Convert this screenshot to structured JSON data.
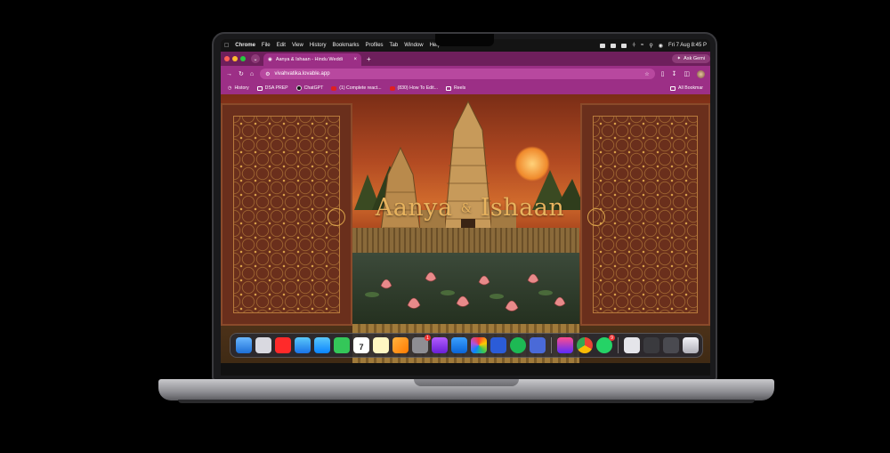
{
  "menubar": {
    "apple_icon": "apple-icon",
    "app_name": "Chrome",
    "menus": [
      "File",
      "Edit",
      "View",
      "History",
      "Bookmarks",
      "Profiles",
      "Tab",
      "Window",
      "Help"
    ],
    "clock": "Fri 7 Aug  8:45 P"
  },
  "tabs": [
    {
      "title": "Aanya & Ishaan - Hindu Weddi"
    }
  ],
  "ask_gemini": "Ask Gemi",
  "address": {
    "url": "vivahvatika.lovable.app"
  },
  "bookmarks": {
    "items": [
      {
        "label": "History",
        "icon": "clock-icon"
      },
      {
        "label": "DSA PREP",
        "icon": "folder-icon"
      },
      {
        "label": "ChatGPT",
        "icon": "chatgpt-icon"
      },
      {
        "label": "(1) Complete react...",
        "icon": "youtube-icon"
      },
      {
        "label": "(830) How To Edit...",
        "icon": "youtube-icon"
      },
      {
        "label": "Reels",
        "icon": "folder-icon"
      }
    ],
    "all_label": "All Bookmar"
  },
  "page": {
    "couple_first": "Aanya",
    "ampersand": "&",
    "couple_second": "Ishaan"
  },
  "dock": {
    "calendar_day": "7",
    "badges": {
      "system_settings": "1",
      "whatsapp": "9"
    }
  },
  "colors": {
    "tab_bar": "#6e1f5c",
    "toolbar": "#9c2f86",
    "title_gold": "#e8b35e",
    "door_brown": "#6a2f1c"
  }
}
